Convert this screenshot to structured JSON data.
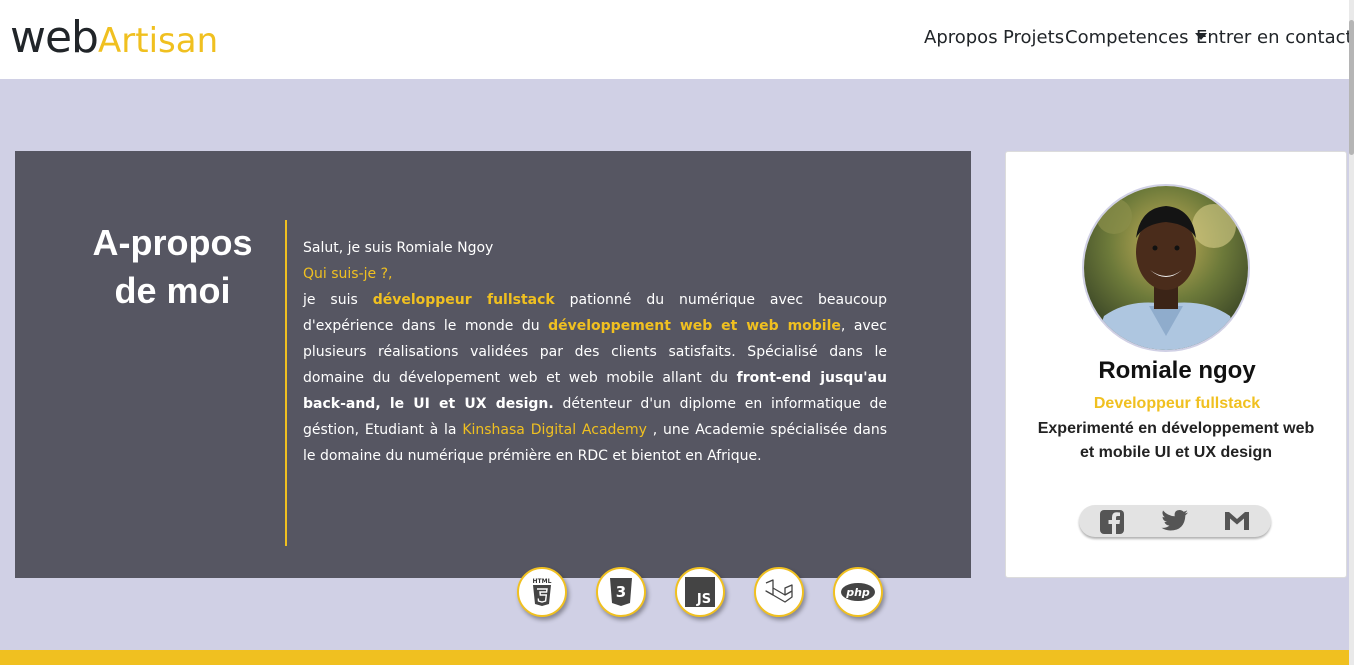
{
  "brand": {
    "web": "web",
    "artisan": "Artisan"
  },
  "nav": {
    "apropos": "Apropos",
    "projets": "Projets",
    "competences": "Competences",
    "contact": "Entrer en contact"
  },
  "about": {
    "title": "A-propos de moi",
    "greeting": "Salut, je suis Romiale Ngoy",
    "question": "Qui suis-je ?,",
    "p1": "je suis ",
    "h1": "développeur fullstack",
    "p2": " pationné du numérique avec beaucoup d'expérience dans le monde du ",
    "h2": "développement web et web mobile",
    "p3": ", avec plusieurs réalisations validées par des clients satisfaits. Spécialisé dans le domaine du dévelopement web et web mobile allant du ",
    "h3": "front-end jusqu'au back-and, le UI et UX design.",
    "p4": " détenteur d'un diplome en informatique de géstion, Etudiant à la ",
    "h4": "Kinshasa Digital Academy",
    "p5": " , une Academie spécialisée dans le domaine du numérique prémière en RDC et bientot en Afrique."
  },
  "tech_icons": [
    {
      "icon": "html5-icon",
      "label": "HTML"
    },
    {
      "icon": "css3-icon",
      "label": "3"
    },
    {
      "icon": "javascript-icon",
      "label": "JS"
    },
    {
      "icon": "laravel-icon"
    },
    {
      "icon": "php-icon",
      "label": "php"
    }
  ],
  "profile": {
    "name": "Romiale ngoy",
    "role": "Developpeur fullstack",
    "desc": "Experimenté en développement web et mobile UI et UX design"
  },
  "social": [
    "facebook-icon",
    "twitter-icon",
    "gmail-icon"
  ],
  "colors": {
    "accent": "#f0c020",
    "panel": "#565662",
    "background": "#d0d0e5"
  }
}
